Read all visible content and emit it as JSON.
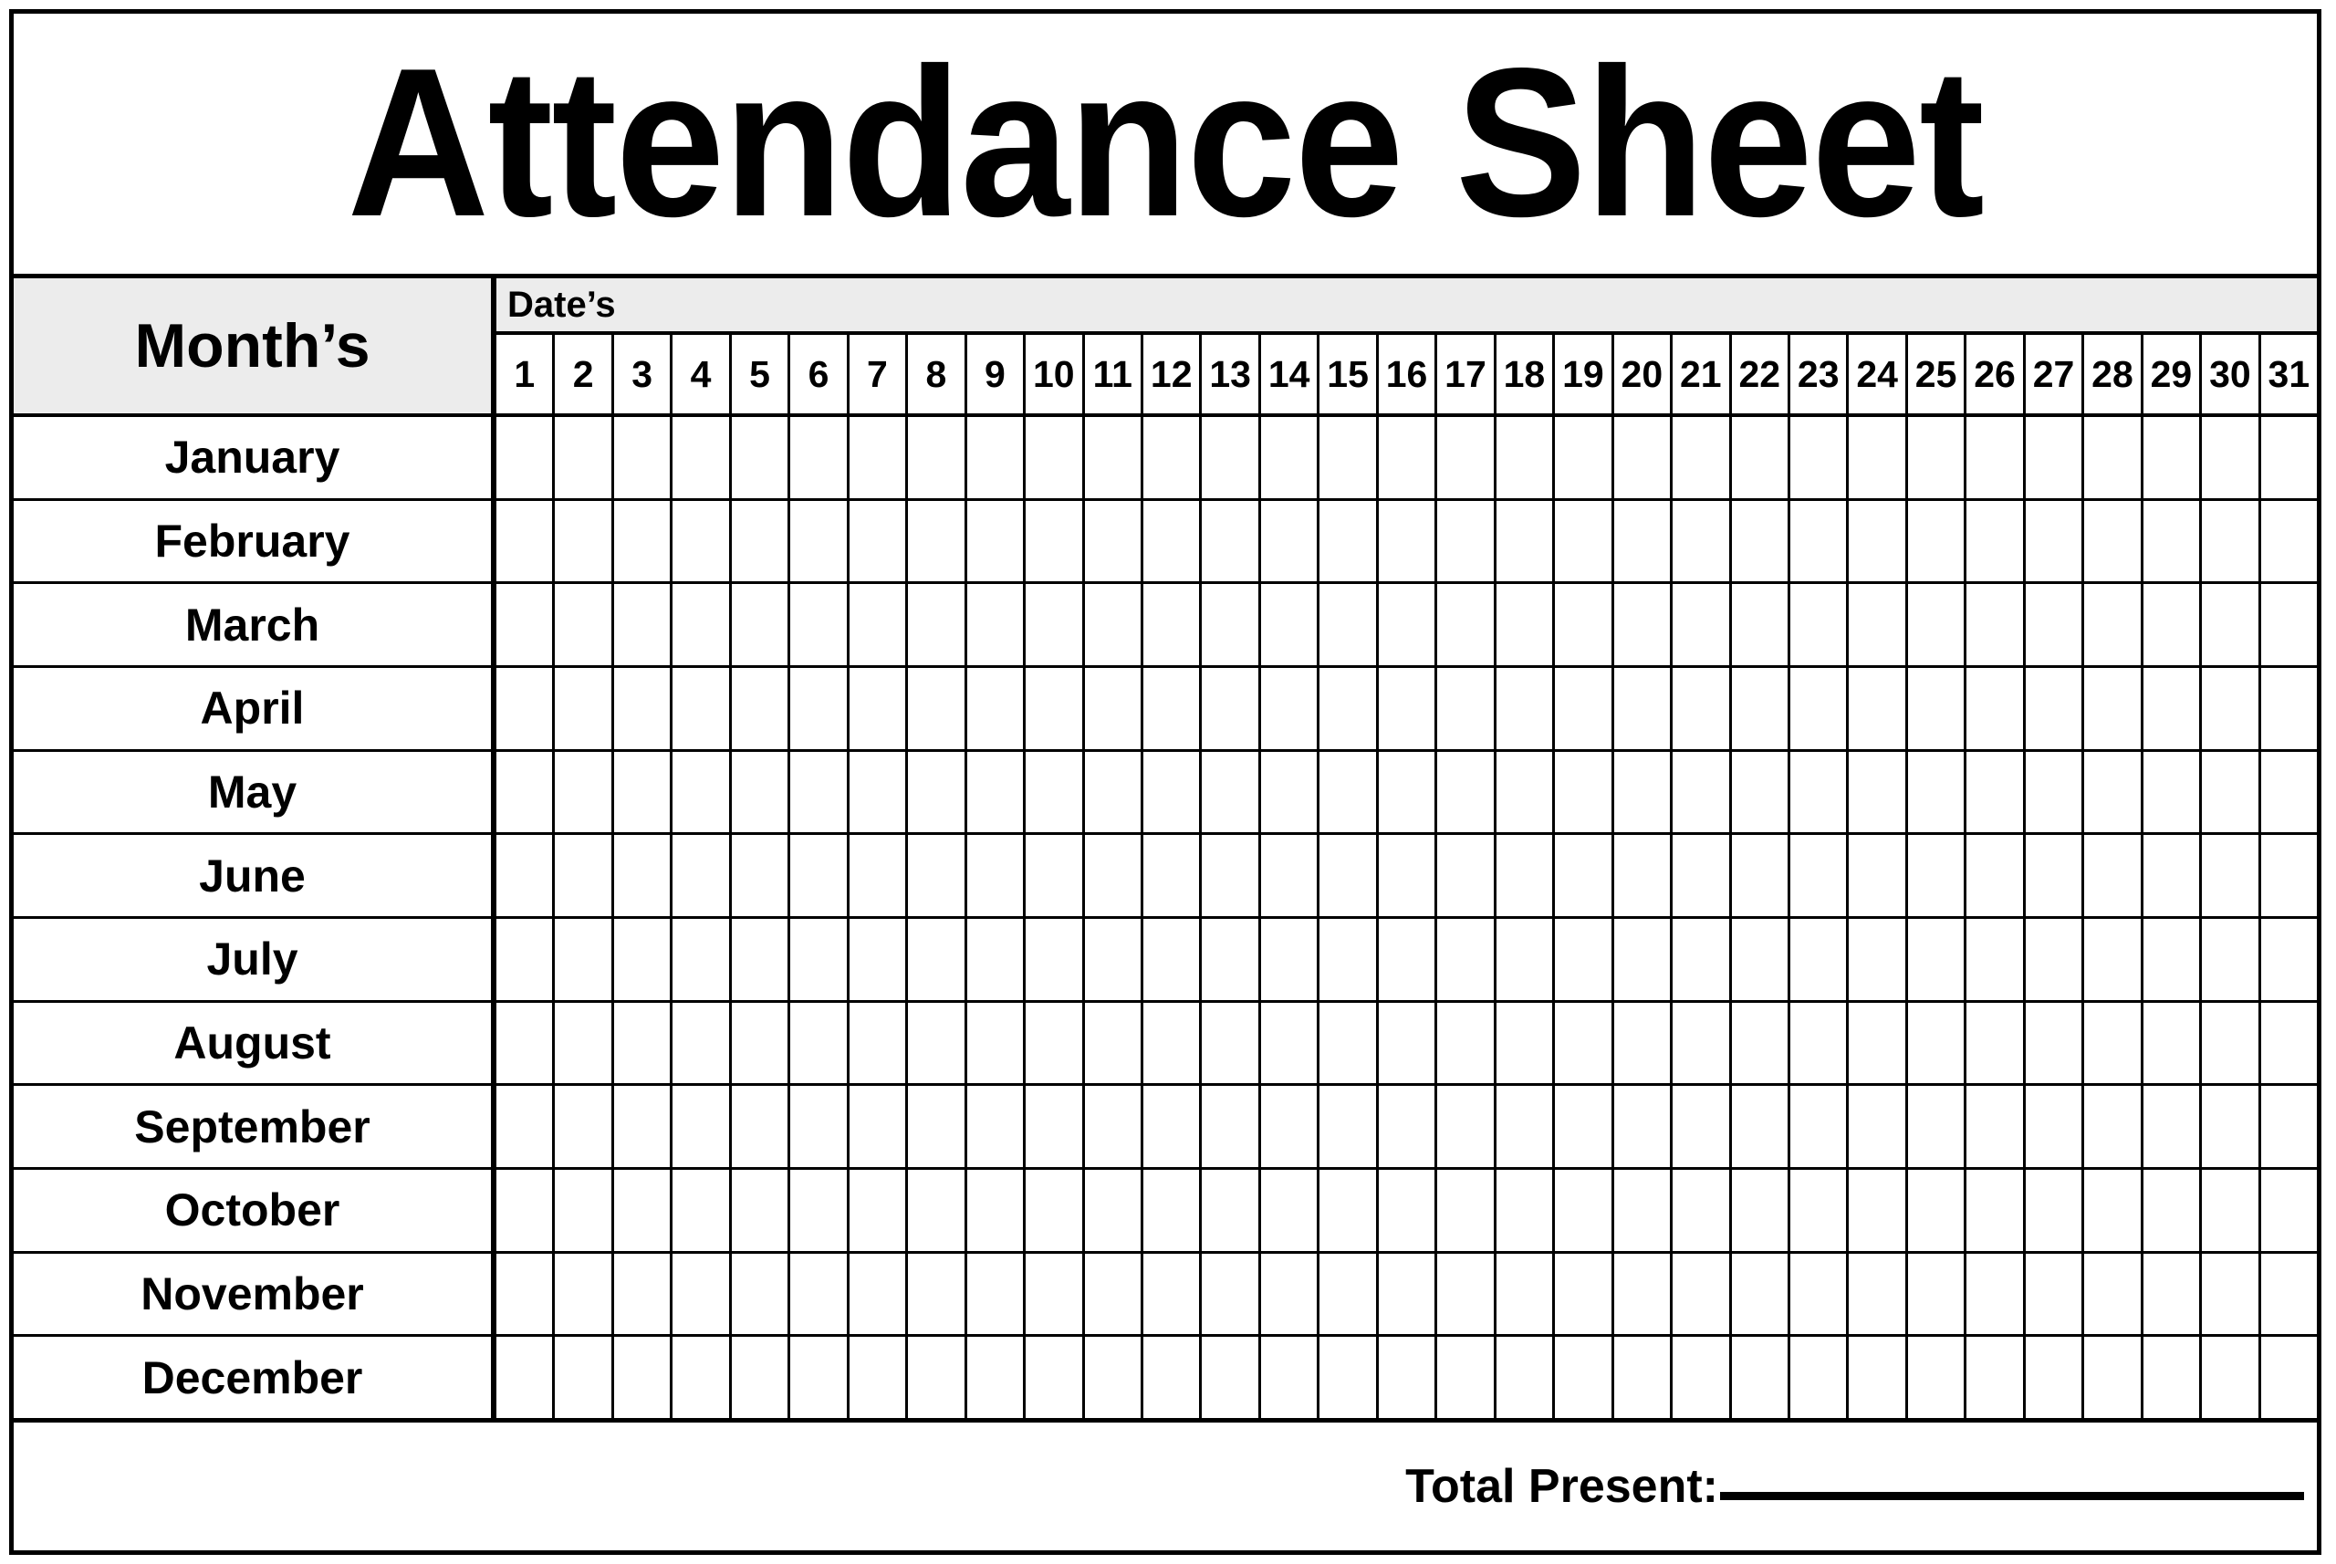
{
  "document": {
    "title": "Attendance Sheet"
  },
  "table": {
    "months_header": "Month’s",
    "dates_header": "Date’s",
    "dates": [
      "1",
      "2",
      "3",
      "4",
      "5",
      "6",
      "7",
      "8",
      "9",
      "10",
      "11",
      "12",
      "13",
      "14",
      "15",
      "16",
      "17",
      "18",
      "19",
      "20",
      "21",
      "22",
      "23",
      "24",
      "25",
      "26",
      "27",
      "28",
      "29",
      "30",
      "31"
    ],
    "months": [
      {
        "name": "January"
      },
      {
        "name": "February"
      },
      {
        "name": "March"
      },
      {
        "name": "April"
      },
      {
        "name": "May"
      },
      {
        "name": "June"
      },
      {
        "name": "July"
      },
      {
        "name": "August"
      },
      {
        "name": "September"
      },
      {
        "name": "October"
      },
      {
        "name": "November"
      },
      {
        "name": "December"
      }
    ]
  },
  "footer": {
    "total_present_label": "Total Present:",
    "total_present_value": ""
  },
  "colors": {
    "header_fill": "#ececec",
    "cell_fill": "#ffffff",
    "border": "#000000",
    "text": "#000000"
  }
}
